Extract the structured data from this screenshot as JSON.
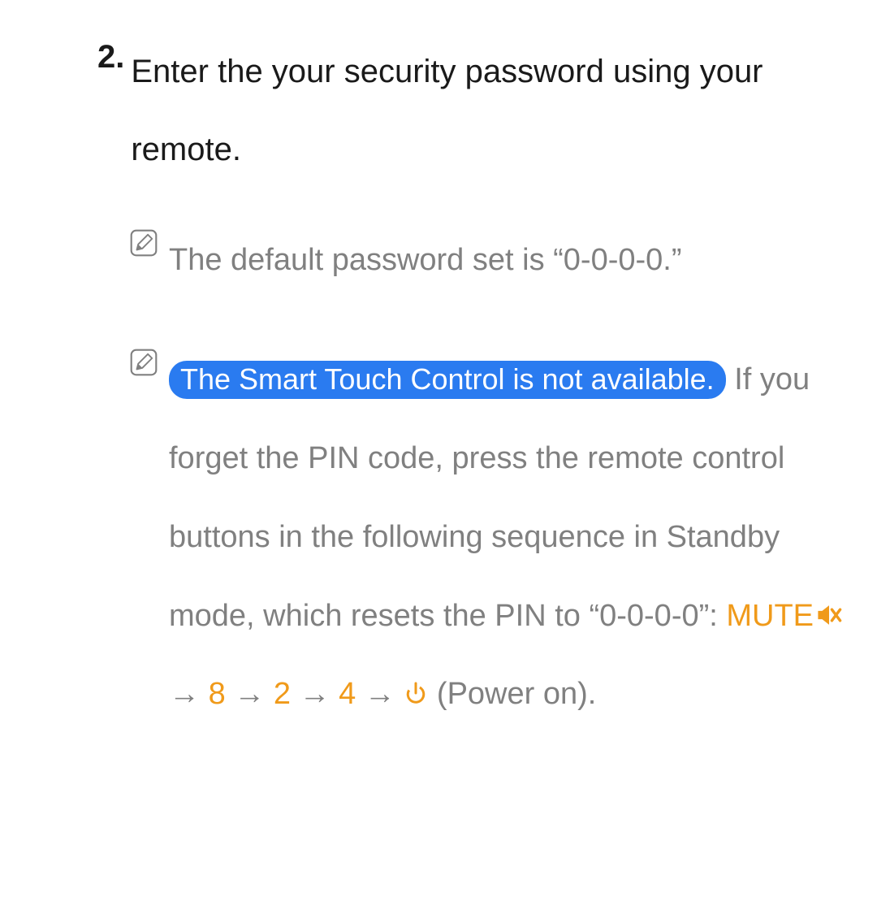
{
  "step": {
    "number": "2.",
    "text": "Enter the your security password using your remote."
  },
  "notes": [
    {
      "text": "The default password set is “0-0-0-0.”"
    },
    {
      "highlight": "The Smart Touch Control is not available.",
      "body_prefix": " If you forget the PIN code, press the remote control buttons in the following sequence in Standby mode, which resets the PIN to “0-0-0-0”: ",
      "sequence": {
        "mute_label": "MUTE",
        "arrow": "→",
        "d1": "8",
        "d2": "2",
        "d3": "4",
        "power_label": "(Power on)."
      }
    }
  ],
  "colors": {
    "accent": "#f09a1a",
    "highlight_bg": "#2a7bf0",
    "body_gray": "#808080"
  }
}
